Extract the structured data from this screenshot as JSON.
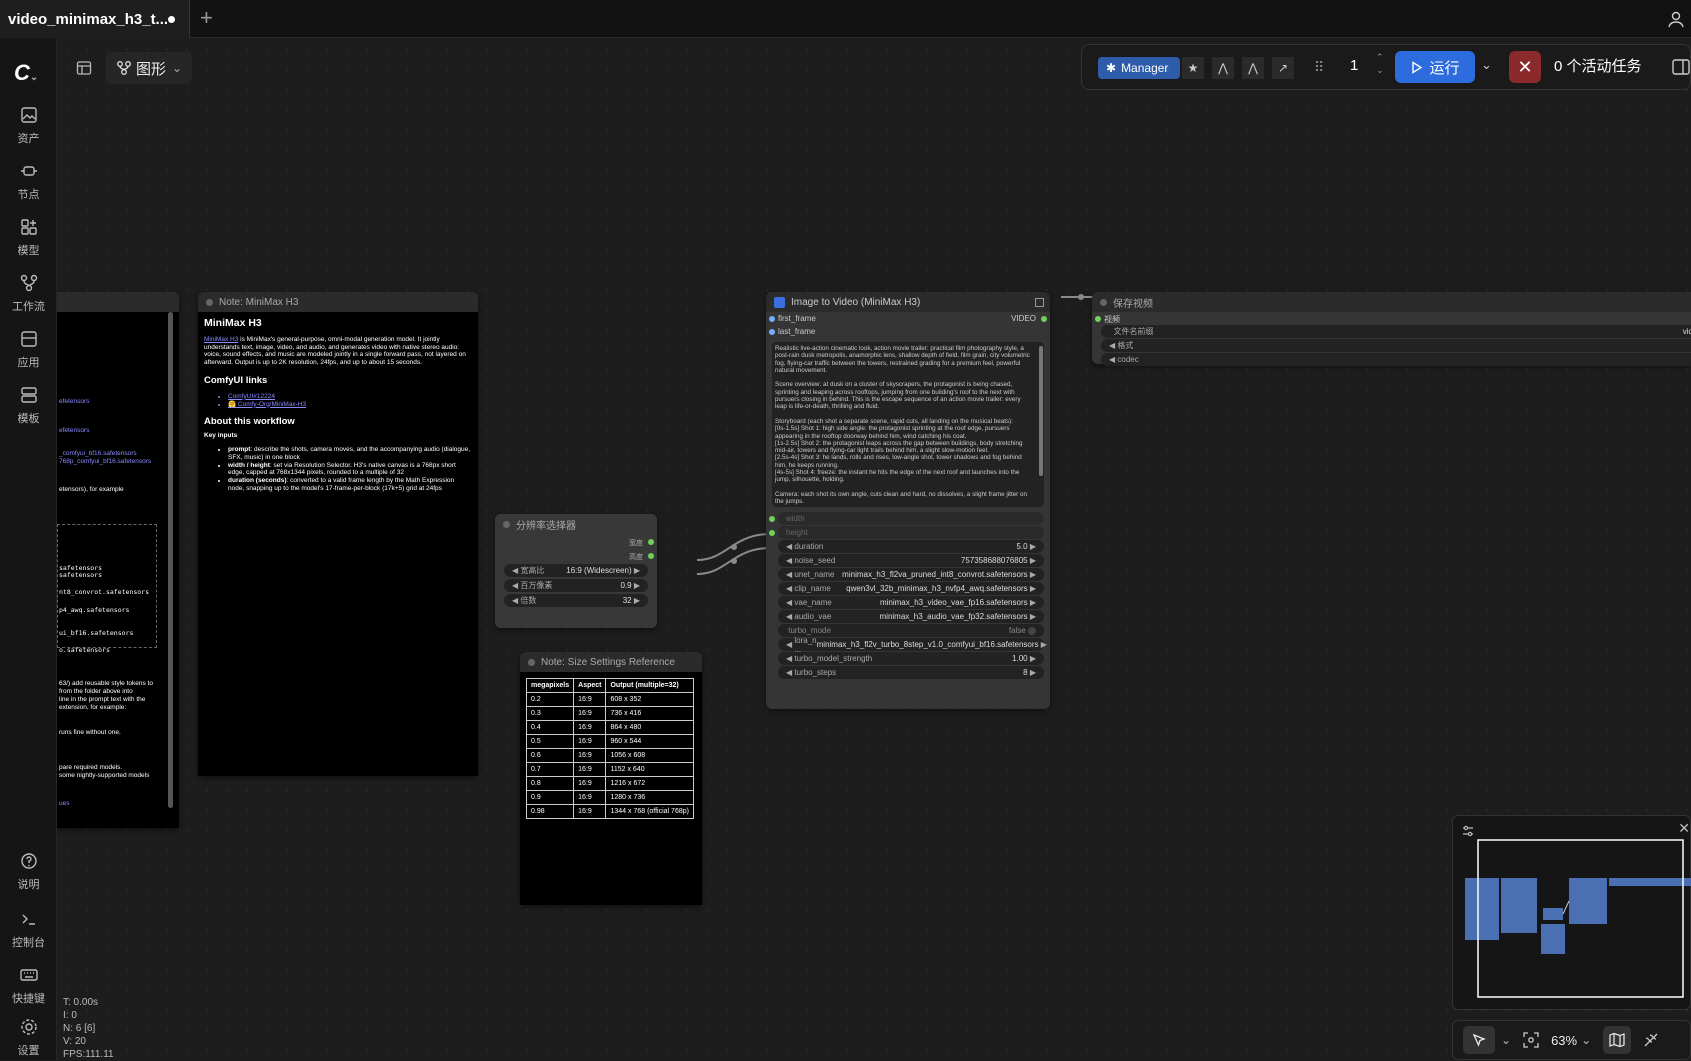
{
  "tab": {
    "title": "video_minimax_h3_t..."
  },
  "sidebar": {
    "items": [
      {
        "label": "资产",
        "icon": "assets-icon"
      },
      {
        "label": "节点",
        "icon": "nodes-icon"
      },
      {
        "label": "模型",
        "icon": "models-icon"
      },
      {
        "label": "工作流",
        "icon": "workflow-icon"
      },
      {
        "label": "应用",
        "icon": "apps-icon"
      },
      {
        "label": "模板",
        "icon": "templates-icon"
      },
      {
        "label": "说明",
        "icon": "help-icon"
      },
      {
        "label": "控制台",
        "icon": "console-icon"
      },
      {
        "label": "快捷键",
        "icon": "keyboard-icon"
      },
      {
        "label": "设置",
        "icon": "settings-icon"
      }
    ]
  },
  "viewbar": {
    "mode_label": "图形"
  },
  "toolbar": {
    "manager_label": "Manager",
    "queue_count": "1",
    "run_label": "运行",
    "tasks_label": "0 个活动任务"
  },
  "note_minimax": {
    "title": "Note: MiniMax H3",
    "heading": "MiniMax H3",
    "intro_link": "MiniMax H3",
    "intro": " is MiniMax's general-purpose, omni-modal generation model. It jointly understands text, image, video, and audio, and generates video with native stereo audio: voice, sound effects, and music are modeled jointly in a single forward pass, not layered on afterward. Output is up to 2K resolution, 24fps, and up to about 15 seconds.",
    "links_heading": "ComfyUI links",
    "link1": "ComfyUI#12224",
    "link2": "🤗 Comfy-Org/MiniMax-H3",
    "about_heading": "About this workflow",
    "key_inputs": "Key inputs",
    "bullets": [
      {
        "b": "prompt",
        "t": ": describe the shots, camera moves, and the accompanying audio (dialogue, SFX, music) in one block"
      },
      {
        "b": "width / height",
        "t": ": set via Resolution Selector. H3's native canvas is a 768px short edge, capped at 768x1344 pixels, rounded to a multiple of 32"
      },
      {
        "b": "duration (seconds)",
        "t": ": converted to a valid frame length by the Math Expression node, snapping up to the model's 17-frame-per-block (17k+5) grid at 24fps"
      }
    ]
  },
  "left_note": {
    "lines": [
      "efetensors",
      "efetensors",
      "_comfyui_bf16.safetensors",
      "768p_comfyui_bf16.safetensors",
      "etensors), for example",
      "safetensors",
      "safetensors",
      "nt8_convrot.safetensors",
      "p4_awq.safetensors",
      "ui_bf16.safetensors",
      "o.safetensors",
      "63/) add reusable style tokens to",
      "from the folder above into",
      "line in the prompt text with the",
      "extension, for example:",
      "runs fine without one.",
      "pare required models.",
      "some nightly-supported models",
      "ues"
    ]
  },
  "res_selector": {
    "title": "分辨率选择器",
    "out_width": "宽度",
    "out_height": "高度",
    "widgets": [
      {
        "label": "宽高比",
        "value": "16:9 (Widescreen)"
      },
      {
        "label": "百万像素",
        "value": "0.9"
      },
      {
        "label": "倍数",
        "value": "32"
      }
    ]
  },
  "size_note": {
    "title": "Note: Size Settings Reference",
    "headers": [
      "megapixels",
      "Aspect",
      "Output (multiple=32)"
    ],
    "rows": [
      [
        "0.2",
        "16:9",
        "608 x 352"
      ],
      [
        "0.3",
        "16:9",
        "736 x 416"
      ],
      [
        "0.4",
        "16:9",
        "864 x 480"
      ],
      [
        "0.5",
        "16:9",
        "960 x 544"
      ],
      [
        "0.6",
        "16:9",
        "1056 x 608"
      ],
      [
        "0.7",
        "16:9",
        "1152 x 640"
      ],
      [
        "0.8",
        "16:9",
        "1216 x 672"
      ],
      [
        "0.9",
        "16:9",
        "1280 x 736"
      ],
      [
        "0.98",
        "16:9",
        "1344 x 768 (official 768p)"
      ]
    ]
  },
  "i2v": {
    "title": "Image to Video (MiniMax H3)",
    "in1": "first_frame",
    "in2": "last_frame",
    "out": "VIDEO",
    "prompt": "Realistic live-action cinematic look, action movie trailer: practical film photography style, a post-rain dusk metropolis, anamorphic lens, shallow depth of field, film grain, city volumetric fog, flying-car traffic between the towers, restrained grading for a premium feel, powerful natural movement.\n\nScene overview: at dusk on a cluster of skyscrapers, the protagonist is being chased, sprinting and leaping across rooftops, jumping from one building's roof to the next with pursuers closing in behind. This is the escape sequence of an action movie trailer: every leap is life-or-death, thrilling and fluid.\n\nStoryboard (each shot a separate scene, rapid cuts, all landing on the musical beats):\n[0s-1.5s] Shot 1: high side angle: the protagonist sprinting at the roof edge, pursuers appearing in the rooftop doorway behind him, wind catching his coat.\n[1s-2.5s] Shot 2: the protagonist leaps across the gap between buildings, body stretching mid-air, towers and flying-car light trails behind him, a slight slow-motion feel.\n[2.5s-4s] Shot 3: he lands, rolls and rises, low-angle shot, tower shadows and fog behind him, he keeps running.\n[4s-5s] Shot 4: freeze: the instant he hits the edge of the next roof and launches into the jump, silhouette, holding.\n\nCamera: each shot its own angle, cuts clean and hard, no dissolves, a slight frame jitter on the jumps.",
    "in_width": "width",
    "in_height": "height",
    "widgets": [
      {
        "label": "duration",
        "value": "5.0"
      },
      {
        "label": "noise_seed",
        "value": "757358688076805"
      },
      {
        "label": "unet_name",
        "value": "minimax_h3_fl2va_pruned_int8_convrot.safetensors"
      },
      {
        "label": "clip_name",
        "value": "qwen3vl_32b_minimax_h3_nvfp4_awq.safetensors"
      },
      {
        "label": "vae_name",
        "value": "minimax_h3_video_vae_fp16.safetensors"
      },
      {
        "label": "audio_vae",
        "value": "minimax_h3_audio_vae_fp32.safetensors"
      },
      {
        "label": "turbo_mode",
        "value": "false"
      },
      {
        "label": "lora_n ...",
        "value": "minimax_h3_fl2v_turbo_8step_v1.0_comfyui_bf16.safetensors"
      },
      {
        "label": "turbo_model_strength",
        "value": "1.00"
      },
      {
        "label": "turbo_steps",
        "value": "8"
      }
    ]
  },
  "save": {
    "title": "保存视频",
    "input": "视频",
    "widgets": [
      {
        "label": "文件名前缀",
        "value": "vid"
      },
      {
        "label": "格式",
        "value": ""
      },
      {
        "label": "codec",
        "value": ""
      }
    ]
  },
  "bottombar": {
    "zoom": "63%"
  },
  "stats": {
    "t": "T: 0.00s",
    "i": "I: 0",
    "n": "N: 6 [6]",
    "v": "V: 20",
    "fps": "FPS:111.11"
  }
}
